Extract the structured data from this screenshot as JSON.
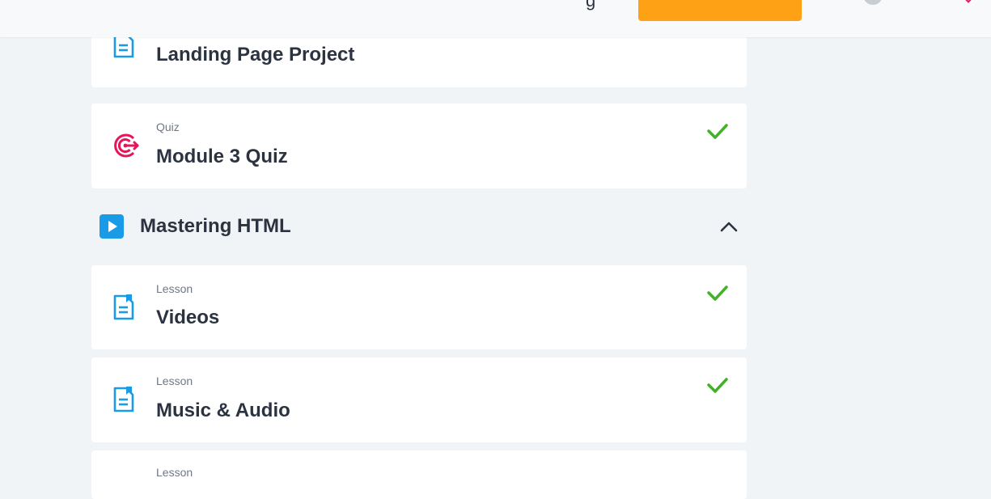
{
  "topbar": {
    "nav_fragment": "g",
    "cta_label": "",
    "colors": {
      "cta": "#ffa114",
      "notification": "#e8145a"
    }
  },
  "curriculum": {
    "items_before": [
      {
        "type": "",
        "title": "Landing Page Project",
        "icon": "lesson-icon",
        "completed": true
      },
      {
        "type": "Quiz",
        "title": "Module 3 Quiz",
        "icon": "quiz-target-icon",
        "completed": true
      }
    ],
    "section": {
      "title": "Mastering HTML",
      "icon": "play-icon",
      "expanded": true
    },
    "items_after": [
      {
        "type": "Lesson",
        "title": "Videos",
        "icon": "lesson-icon",
        "completed": true
      },
      {
        "type": "Lesson",
        "title": "Music & Audio",
        "icon": "lesson-icon",
        "completed": true
      },
      {
        "type": "Lesson",
        "title": "",
        "icon": "lesson-icon",
        "completed": false
      }
    ]
  },
  "colors": {
    "background": "#f1f4f7",
    "lesson_icon": "#1a9be8",
    "quiz_icon": "#e8145a",
    "check": "#43b02a",
    "section_play": "#1a9be8"
  }
}
